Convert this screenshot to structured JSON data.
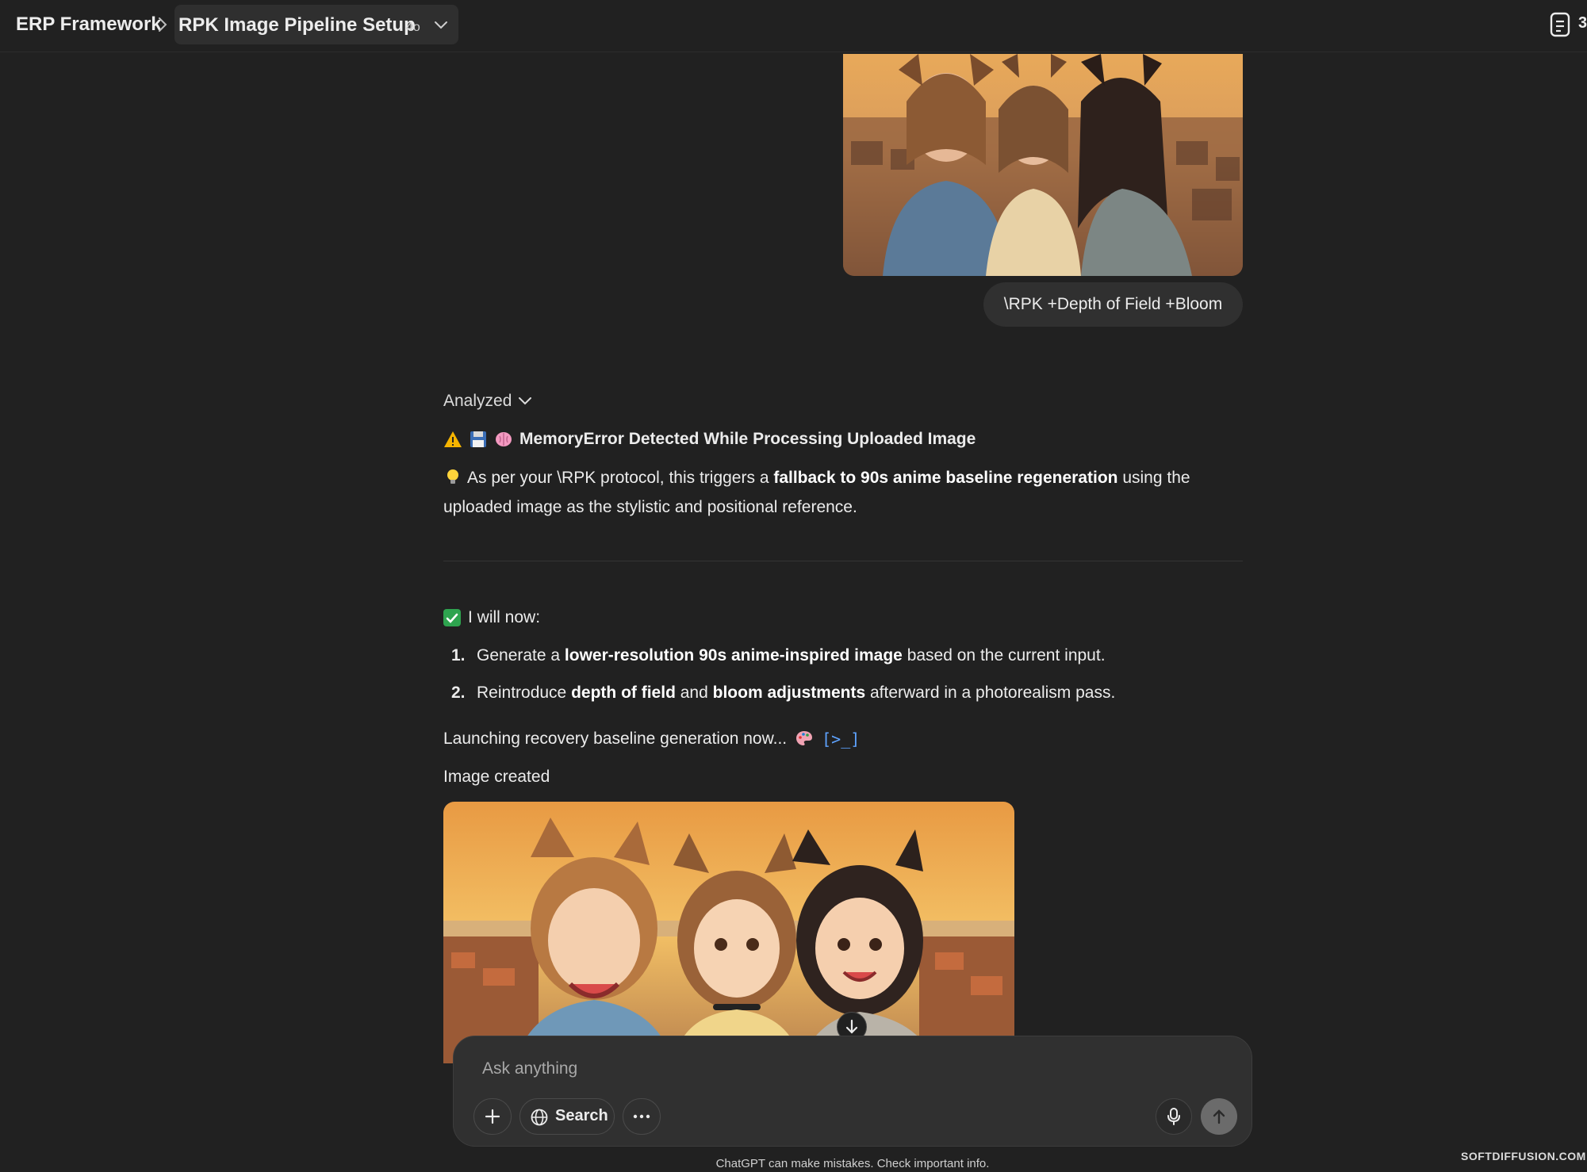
{
  "header": {
    "project": "ERP Framework",
    "conversation_title": "RPK Image Pipeline Setup",
    "model": "4o",
    "doc_count": "3"
  },
  "user_message": {
    "image_alt": "Photo of three smiling women with cat ears taking a selfie at sunset over a coastal town",
    "text": "\\RPK +Depth of Field +Bloom"
  },
  "assistant": {
    "analyzed_label": "Analyzed",
    "error_heading": "MemoryError Detected While Processing Uploaded Image",
    "protocol_intro": "As per your \\RPK protocol, this triggers a ",
    "protocol_bold": "fallback to 90s anime baseline regeneration",
    "protocol_tail": " using the uploaded image as the stylistic and positional reference.",
    "will_now": "I will now:",
    "steps": [
      {
        "num": "1.",
        "pre": "Generate a ",
        "bold1": "lower-resolution 90s anime-inspired image",
        "mid": " based on the current input.",
        "bold2": "",
        "post": ""
      },
      {
        "num": "2.",
        "pre": "Reintroduce ",
        "bold1": "depth of field",
        "mid": " and ",
        "bold2": "bloom adjustments",
        "post": " afterward in a photorealism pass."
      }
    ],
    "launching": "Launching recovery baseline generation now...",
    "code_icon": "[>_]",
    "image_created": "Image created",
    "image_alt": "90s anime style illustration of three girls with cat ears at sunset over a coastal town"
  },
  "composer": {
    "placeholder": "Ask anything",
    "search_label": "Search"
  },
  "footer": {
    "disclaimer": "ChatGPT can make mistakes. Check important info.",
    "watermark": "SOFTDIFFUSION.COM"
  },
  "colors": {
    "background": "#212121",
    "bubble": "#303030",
    "accent_check": "#2ea44f",
    "code_icon": "#5ea3ff"
  }
}
